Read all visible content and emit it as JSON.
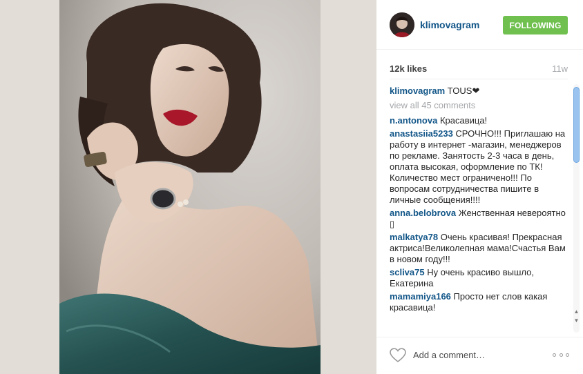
{
  "post": {
    "username": "klimovagram",
    "follow_label": "FOLLOWING",
    "likes": "12k likes",
    "time": "11w",
    "caption": {
      "author": "klimovagram",
      "text": " TOUS❤"
    },
    "view_all": "view all 45 comments",
    "comments": [
      {
        "author": "n.antonova",
        "text": " Красавица!"
      },
      {
        "author": "anastasiia5233",
        "text": " СРОЧНО!!! Приглашаю на работу в интернет -магазин, менеджеров по рекламе. Занятость 2-3 часа в день, оплата высокая, оформление по ТК! Количество мест ограничено!!! По вопросам сотрудничества пишите в личные сообщения!!!!"
      },
      {
        "author": "anna.belobrova",
        "text": " Женственная невероятно ▯"
      },
      {
        "author": "malkatya78",
        "text": " Очень красивая! Прекрасная актриса!Великолепная мама!Счастья Вам в новом году!!!"
      },
      {
        "author": "scliva75",
        "text": " Ну очень красиво вышло, Екатерина"
      },
      {
        "author": "mamamiya166",
        "text": " Просто нет слов какая красавица!"
      }
    ]
  },
  "footer": {
    "add_comment_placeholder": "Add a comment…",
    "like_icon": "heart-outline-icon",
    "more_icon": "more-dots-icon"
  },
  "colors": {
    "link_blue": "#125688",
    "follow_green": "#70c050",
    "muted_gray": "#a5a7aa",
    "dress_teal": "#2c5a5c",
    "lip_red": "#a8172a"
  }
}
